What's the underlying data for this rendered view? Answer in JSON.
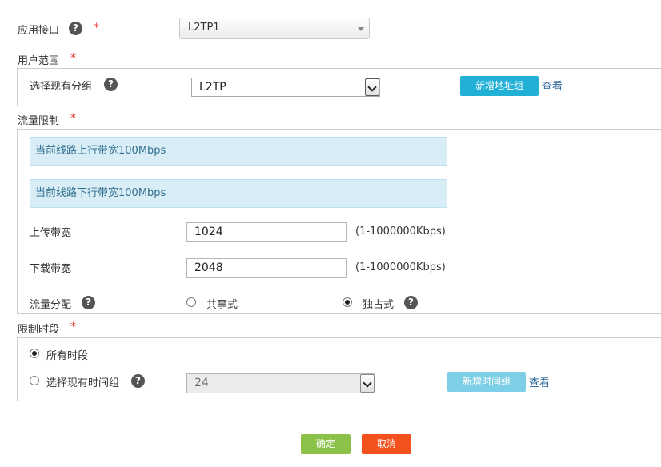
{
  "interface": {
    "label": "应用接口",
    "required_mark": "*",
    "selected": "L2TP1"
  },
  "user_scope": {
    "label": "用户范围",
    "required_mark": "*",
    "group_label": "选择现有分组",
    "group_selected": "L2TP",
    "add_button": "新增地址组",
    "view_link": "查看"
  },
  "traffic_limit": {
    "label": "流量限制",
    "required_mark": "*",
    "uplink_info": "当前线路上行带宽100Mbps",
    "downlink_info": "当前线路下行带宽100Mbps",
    "upload_label": "上传带宽",
    "upload_value": "1024",
    "upload_range": "(1-1000000Kbps)",
    "download_label": "下载带宽",
    "download_value": "2048",
    "download_range": "(1-1000000Kbps)",
    "distribution_label": "流量分配",
    "shared_option": "共享式",
    "exclusive_option": "独占式",
    "distribution_selected": "exclusive"
  },
  "time_limit": {
    "label": "限制时段",
    "required_mark": "*",
    "all_time_option": "所有时段",
    "existing_group_option": "选择现有时间组",
    "time_group_selected": "24",
    "selected_option": "all_time",
    "add_button": "新增时间组",
    "view_link": "查看"
  },
  "actions": {
    "confirm_label": "确定",
    "cancel_label": "取消"
  },
  "icons": {
    "help": "help-icon",
    "dropdown": "chevron-down-icon"
  },
  "colors": {
    "primary_button": "#23b0d6",
    "confirm_button": "#8bc34a",
    "cancel_button": "#f4511e",
    "info_background": "#d9edf7",
    "required_mark": "#e53935",
    "link": "#2a6496"
  }
}
